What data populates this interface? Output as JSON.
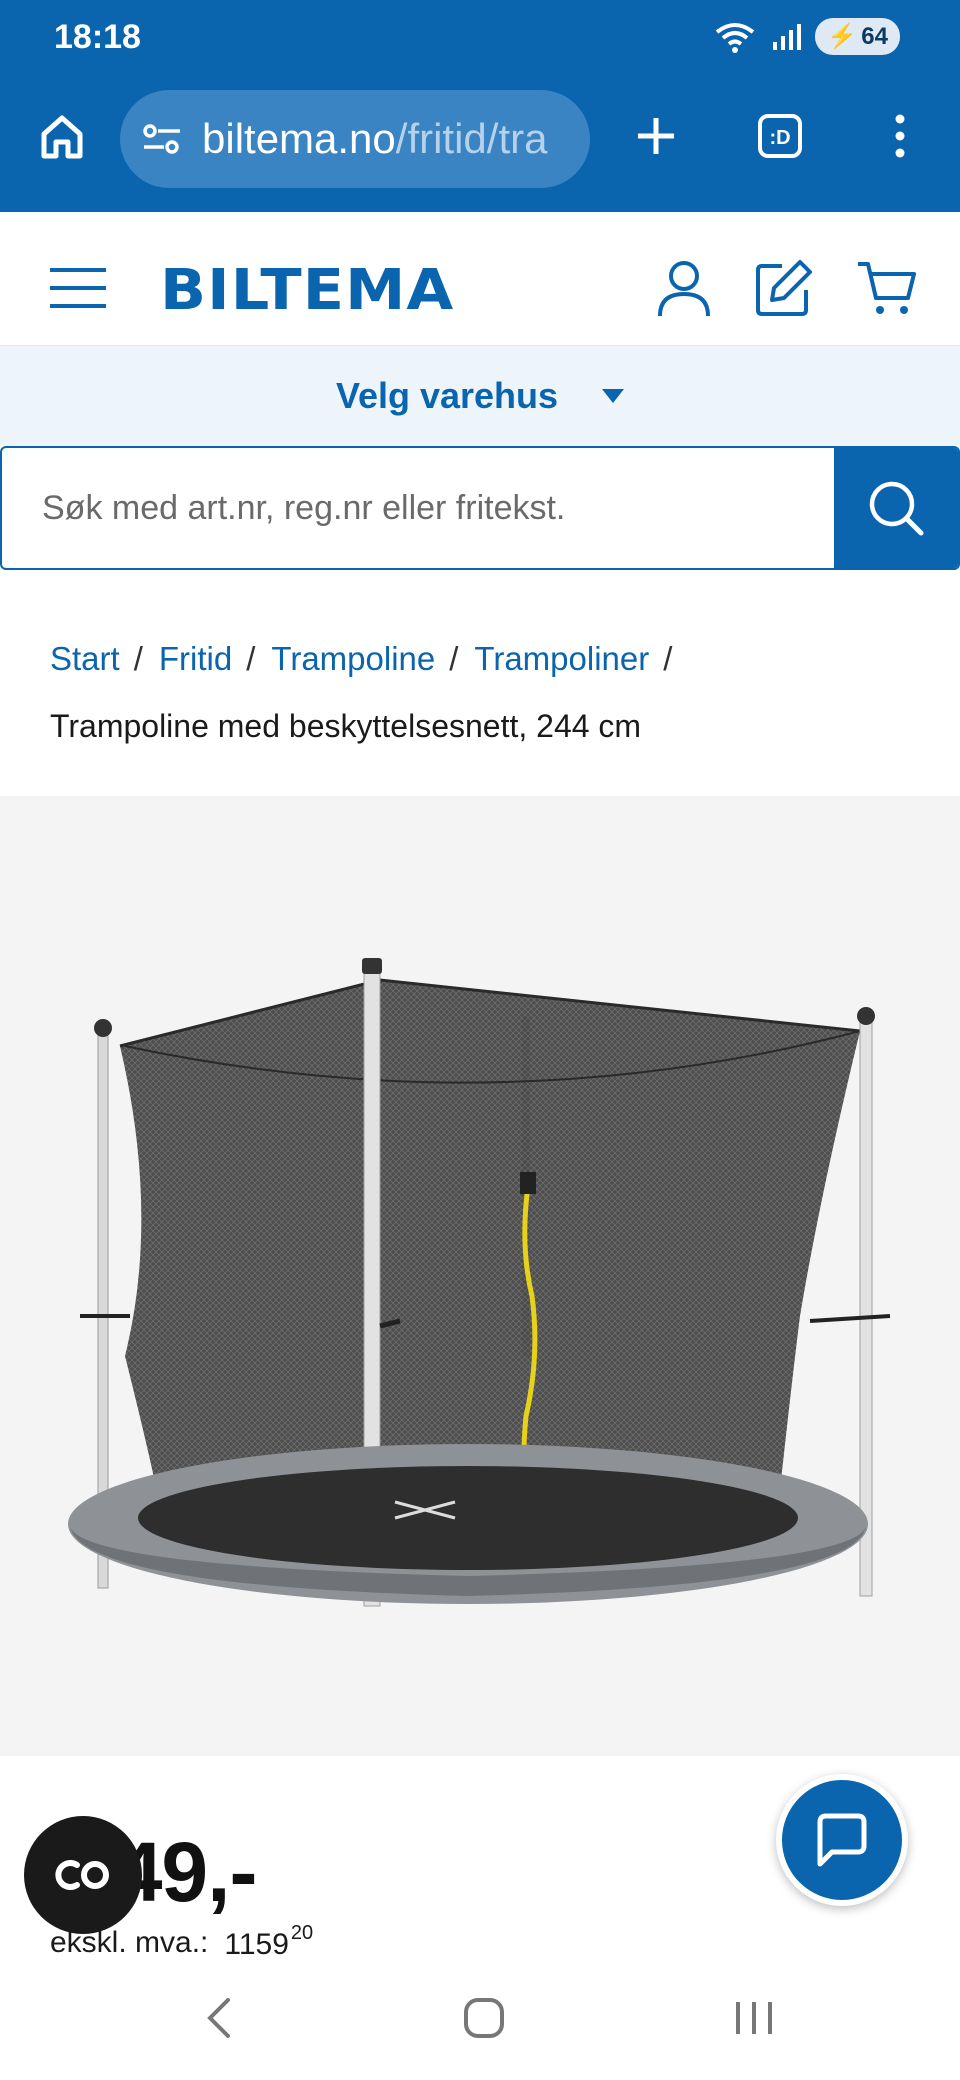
{
  "status_bar": {
    "time": "18:18",
    "network": "5",
    "battery": "64"
  },
  "browser": {
    "url_domain": "biltema.no",
    "url_path": "/fritid/tra",
    "icons": [
      "home-icon",
      "site-settings-icon",
      "new-tab-icon",
      "tab-switcher-icon",
      "menu-icon"
    ],
    "tab_label": ":D"
  },
  "header": {
    "logo": "BILTEMA",
    "icons": [
      "hamburger-menu-icon",
      "account-icon",
      "edit-list-icon",
      "cart-icon"
    ]
  },
  "store_selector": {
    "label": "Velg varehus"
  },
  "search": {
    "placeholder": "Søk med art.nr, reg.nr eller fritekst."
  },
  "breadcrumb": {
    "items": [
      "Start",
      "Fritid",
      "Trampoline",
      "Trampoliner"
    ],
    "separator": "/",
    "current": "Trampoline med beskyttelsesnett, 244 cm"
  },
  "product": {
    "image_alt": "trampoline-with-safety-net",
    "price_visible": "449,-",
    "ex_vat_label": "ekskl. mva.:",
    "ex_vat_value": "1159",
    "ex_vat_cents": "20"
  },
  "floating": {
    "cookie_label": "CO",
    "chat_icon": "chat-bubble-icon"
  },
  "colors": {
    "brand": "#0a64ae",
    "store_bar_bg": "#edf5fb",
    "image_bg": "#f4f4f4"
  }
}
